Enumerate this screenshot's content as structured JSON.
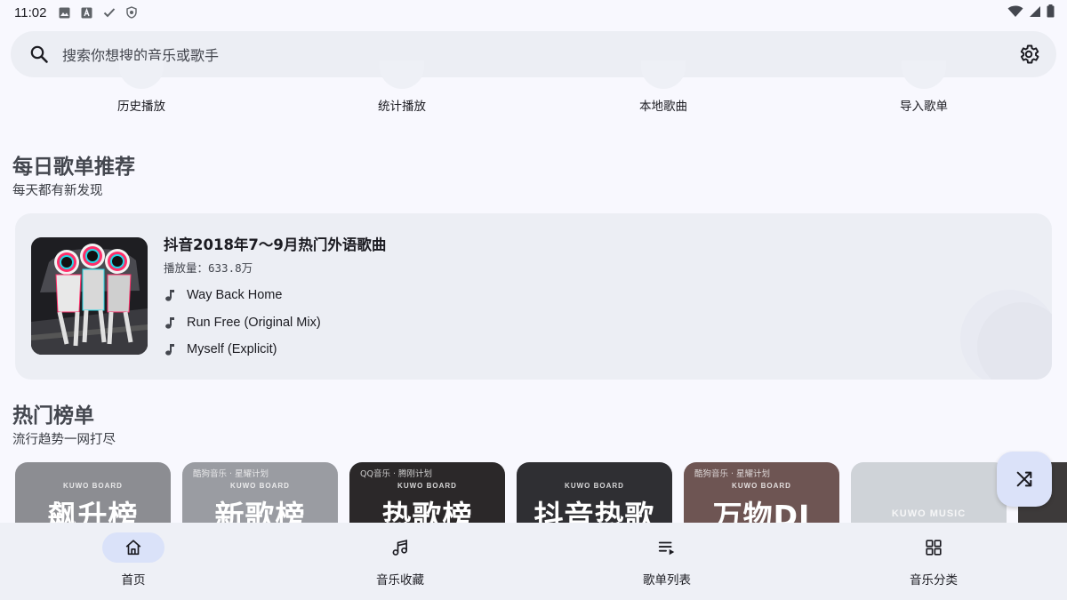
{
  "status": {
    "time": "11:02",
    "left_icons": [
      "image-icon",
      "font-icon",
      "check-icon",
      "shield-icon"
    ],
    "right_icons": [
      "wifi-icon",
      "signal-icon",
      "battery-icon"
    ]
  },
  "search": {
    "placeholder": "搜索你想搜的音乐或歌手"
  },
  "quick_actions": [
    {
      "label": "历史播放"
    },
    {
      "label": "统计播放"
    },
    {
      "label": "本地歌曲"
    },
    {
      "label": "导入歌单"
    }
  ],
  "daily": {
    "title": "每日歌单推荐",
    "subtitle": "每天都有新发现",
    "playlist": {
      "title": "抖音2018年7～9月热门外语歌曲",
      "plays": "播放量：633.8万",
      "songs": [
        "Way Back Home",
        "Run Free (Original Mix)",
        "Myself (Explicit)"
      ]
    }
  },
  "hot": {
    "title": "热门榜单",
    "subtitle": "流行趋势一网打尽",
    "charts": [
      {
        "brand": "",
        "tag": "KUWO BOARD",
        "name": "飙升榜",
        "color": "#8c8d92"
      },
      {
        "brand": "酷狗音乐 · 星耀计划",
        "tag": "KUWO BOARD",
        "name": "新歌榜",
        "color": "#9a9ca2"
      },
      {
        "brand": "QQ音乐 · 腾刚计划",
        "tag": "KUWO BOARD",
        "name": "热歌榜",
        "color": "#2b2829"
      },
      {
        "brand": "",
        "tag": "KUWO BOARD",
        "name": "抖音热歌",
        "color": "#2f2f33"
      },
      {
        "brand": "酷狗音乐 · 星耀计划",
        "tag": "KUWO BOARD",
        "name": "万物DJ",
        "color": "#6e5553"
      },
      {
        "brand": "",
        "tag": "KUWO MUSIC",
        "name": "",
        "color": "#cfd3d8"
      },
      {
        "brand": "",
        "tag": "",
        "name": "",
        "color": "#3d3a3a"
      }
    ]
  },
  "fab": {
    "icon": "shuffle-icon"
  },
  "nav": [
    {
      "label": "首页",
      "icon": "home-icon",
      "active": true
    },
    {
      "label": "音乐收藏",
      "icon": "music-collection-icon",
      "active": false
    },
    {
      "label": "歌单列表",
      "icon": "playlist-icon",
      "active": false
    },
    {
      "label": "音乐分类",
      "icon": "category-icon",
      "active": false
    }
  ]
}
